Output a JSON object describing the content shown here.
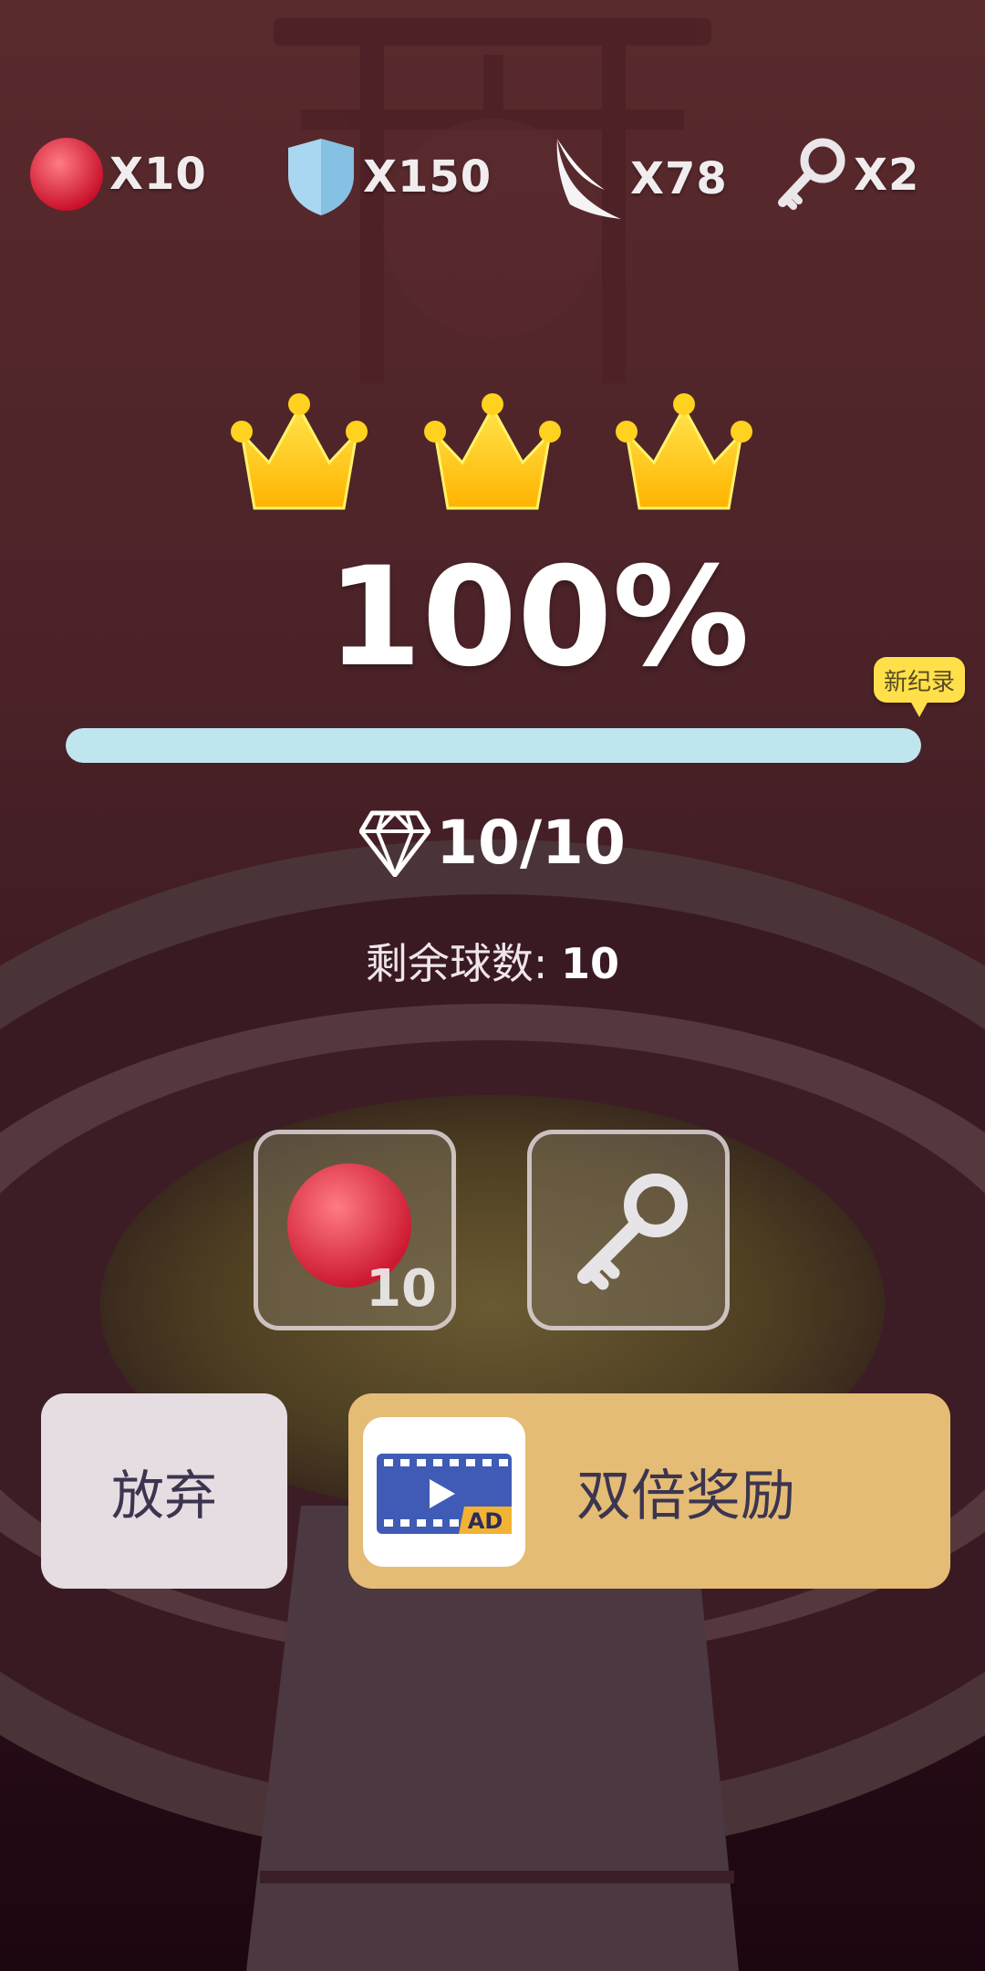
{
  "resources": [
    {
      "icon": "red-ball-icon",
      "count": "X10"
    },
    {
      "icon": "shield-icon",
      "count": "X150"
    },
    {
      "icon": "wing-icon",
      "count": "X78"
    },
    {
      "icon": "key-icon",
      "count": "X2"
    }
  ],
  "crowns": {
    "earned": 3,
    "total": 3
  },
  "progress": {
    "percent_text": "100%",
    "fill_fraction": 1.0,
    "record_badge": "新纪录"
  },
  "gems": {
    "text": "10/10"
  },
  "remaining": {
    "label": "剩余球数:",
    "value": "10"
  },
  "slots": {
    "ball_count": "10"
  },
  "buttons": {
    "give_up": "放弃",
    "double_reward": "双倍奖励",
    "ad_badge": "AD"
  },
  "colors": {
    "progress_fill": "#bfe6ee",
    "giveup_bg": "#e6dde2",
    "double_bg": "#e5bc75",
    "crown": "#ffc21a"
  }
}
